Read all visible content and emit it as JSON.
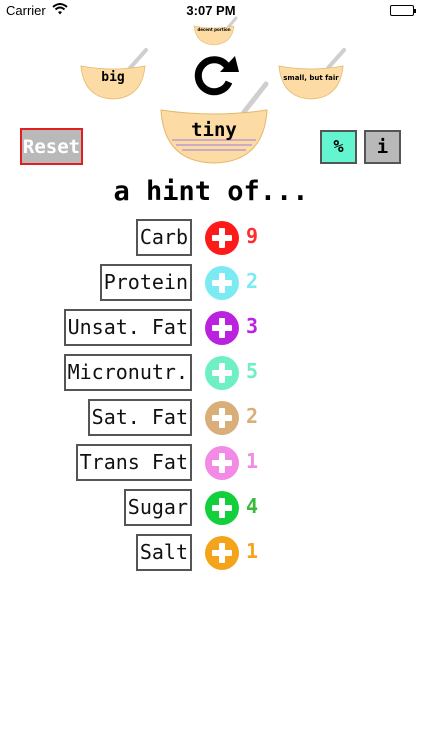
{
  "status_bar": {
    "carrier": "Carrier",
    "time": "3:07 PM",
    "wifi_icon": "wifi-icon",
    "battery_icon": "battery-icon"
  },
  "bowls": {
    "top": "decent portion",
    "left": "big",
    "right": "small, but fair",
    "center": "tiny"
  },
  "controls": {
    "reset": "Reset",
    "percent": "%",
    "info": "i",
    "refresh_icon": "refresh-icon"
  },
  "heading": "a hint of...",
  "nutrients": [
    {
      "label": "Carb",
      "count": "9",
      "color": "#ff1a1a",
      "count_color": "#ff2d2d"
    },
    {
      "label": "Protein",
      "count": "2",
      "color": "#7ceaf2",
      "count_color": "#7ceaf2"
    },
    {
      "label": "Unsat. Fat",
      "count": "3",
      "color": "#bb22e0",
      "count_color": "#bb22e0"
    },
    {
      "label": "Micronutr.",
      "count": "5",
      "color": "#6ef0c4",
      "count_color": "#6ef0c4"
    },
    {
      "label": "Sat. Fat",
      "count": "2",
      "color": "#d9ae78",
      "count_color": "#d9ae78"
    },
    {
      "label": "Trans Fat",
      "count": "1",
      "color": "#f28ae6",
      "count_color": "#f28ae6"
    },
    {
      "label": "Sugar",
      "count": "4",
      "color": "#14cf3c",
      "count_color": "#3cb83c"
    },
    {
      "label": "Salt",
      "count": "1",
      "color": "#f4a41a",
      "count_color": "#f4a41a"
    }
  ],
  "colors": {
    "bowl": "#fddba5",
    "reset_border": "#e02020",
    "percent_bg": "#63f5cf",
    "button_gray": "#b9b9b9"
  }
}
